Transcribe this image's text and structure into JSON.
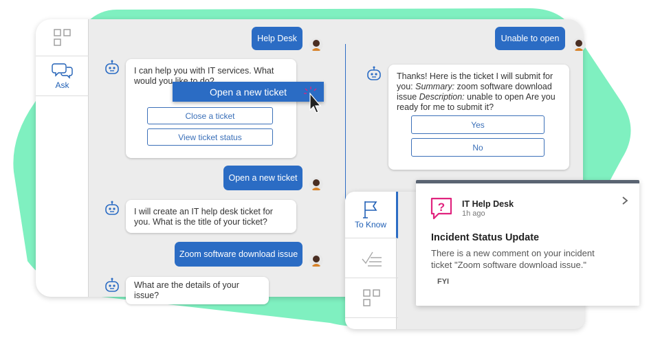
{
  "sidebar": {
    "items": [
      {
        "icon": "grid-icon",
        "label": ""
      },
      {
        "icon": "chat-icon",
        "label": "Ask"
      }
    ]
  },
  "chat_left": {
    "user_msg_1": "Help Desk",
    "bot_msg_1": "I can help you with IT services. What would you like to do?",
    "options": [
      "Open a new ticket",
      "Close a ticket",
      "View ticket status"
    ],
    "user_msg_2": "Open a new ticket",
    "bot_msg_2": "I will create an IT help desk ticket for you. What is the title of your ticket?",
    "user_msg_3": "Zoom software download issue",
    "bot_msg_3": "What are the details of your issue?"
  },
  "chat_right": {
    "user_msg": "Unable to open",
    "bot_msg_parts": {
      "intro": "Thanks! Here is the ticket I will submit for you: ",
      "summary_label": "Summary:",
      "summary_text": " zoom software download issue ",
      "desc_label": "Description:",
      "desc_text": " unable to open Are you ready for me to submit it?"
    },
    "yes_label": "Yes",
    "no_label": "No"
  },
  "teams_sidebar": {
    "items": [
      {
        "icon": "flag-icon",
        "label": "To Know"
      },
      {
        "icon": "checklist-icon",
        "label": ""
      },
      {
        "icon": "grid-icon",
        "label": ""
      }
    ]
  },
  "notification": {
    "app_name": "IT Help Desk",
    "time": "1h ago",
    "title": "Incident Status Update",
    "body": "There is a new comment on your incident ticket \"Zoom software download issue.\"",
    "tag": "FYI",
    "accent_color": "#e0237e",
    "header_bar_color": "#5a6472"
  },
  "colors": {
    "primary": "#2b6cc4",
    "blob": "#7ff0c0"
  }
}
